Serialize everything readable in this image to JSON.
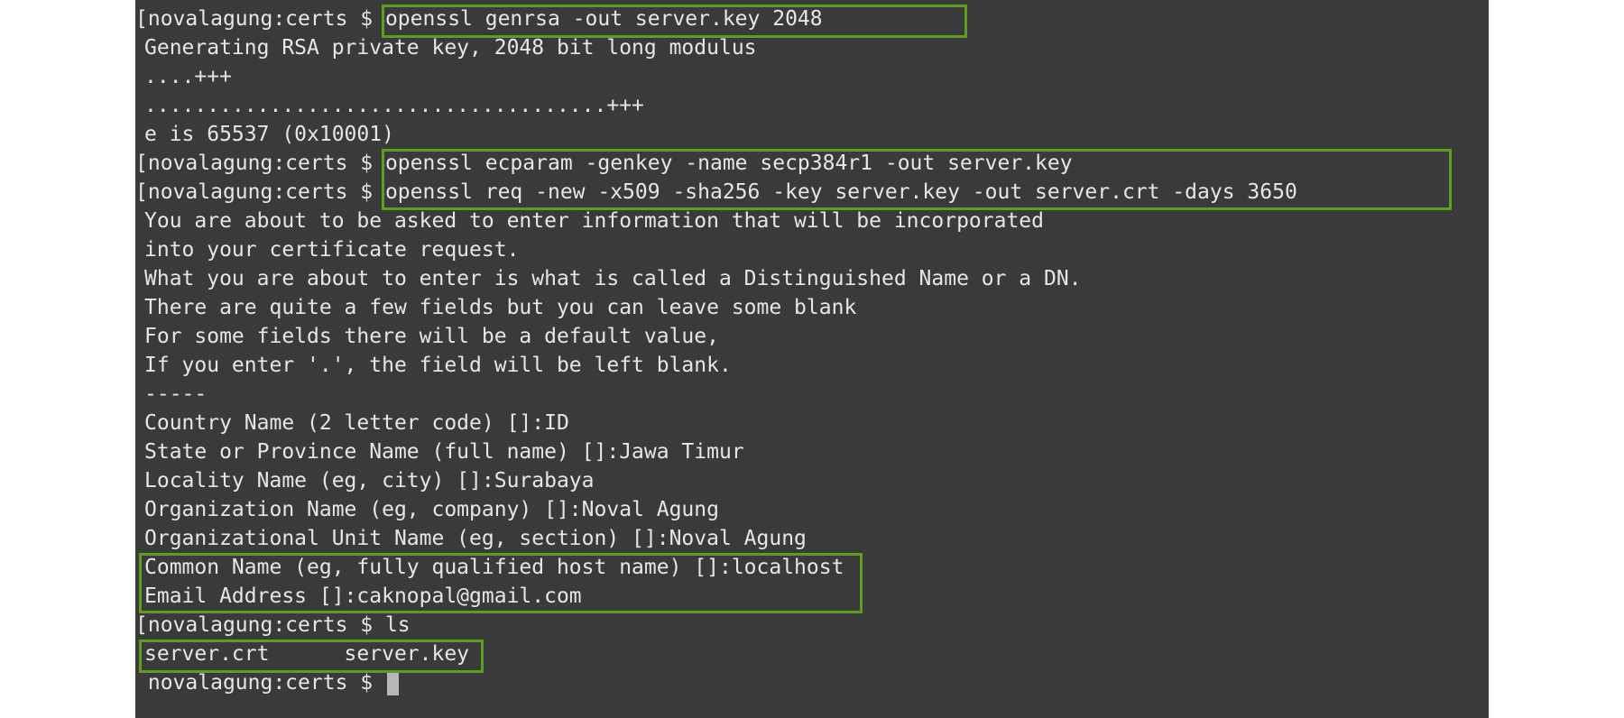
{
  "terminal": {
    "prompt": "novalagung:certs $",
    "prompt_open_bracket": "[",
    "lines": [
      {
        "type": "cmd",
        "bracket": true,
        "text": "openssl genrsa -out server.key 2048"
      },
      {
        "type": "out",
        "text": "Generating RSA private key, 2048 bit long modulus"
      },
      {
        "type": "out",
        "text": "....+++"
      },
      {
        "type": "out",
        "text": ".....................................+++"
      },
      {
        "type": "out",
        "text": "e is 65537 (0x10001)"
      },
      {
        "type": "cmd",
        "bracket": true,
        "text": "openssl ecparam -genkey -name secp384r1 -out server.key"
      },
      {
        "type": "cmd",
        "bracket": true,
        "text": "openssl req -new -x509 -sha256 -key server.key -out server.crt -days 3650"
      },
      {
        "type": "out",
        "text": "You are about to be asked to enter information that will be incorporated"
      },
      {
        "type": "out",
        "text": "into your certificate request."
      },
      {
        "type": "out",
        "text": "What you are about to enter is what is called a Distinguished Name or a DN."
      },
      {
        "type": "out",
        "text": "There are quite a few fields but you can leave some blank"
      },
      {
        "type": "out",
        "text": "For some fields there will be a default value,"
      },
      {
        "type": "out",
        "text": "If you enter '.', the field will be left blank."
      },
      {
        "type": "out",
        "text": "-----"
      },
      {
        "type": "out",
        "text": "Country Name (2 letter code) []:ID"
      },
      {
        "type": "out",
        "text": "State or Province Name (full name) []:Jawa Timur"
      },
      {
        "type": "out",
        "text": "Locality Name (eg, city) []:Surabaya"
      },
      {
        "type": "out",
        "text": "Organization Name (eg, company) []:Noval Agung"
      },
      {
        "type": "out",
        "text": "Organizational Unit Name (eg, section) []:Noval Agung"
      },
      {
        "type": "out",
        "text": "Common Name (eg, fully qualified host name) []:localhost"
      },
      {
        "type": "out",
        "text": "Email Address []:caknopal@gmail.com"
      },
      {
        "type": "cmd",
        "bracket": true,
        "text": "ls"
      },
      {
        "type": "out",
        "text": "server.crt      server.key"
      },
      {
        "type": "cmd",
        "bracket": false,
        "text": "",
        "cursor": true
      }
    ]
  },
  "colors": {
    "background": "#3a3a3a",
    "text": "#e6e6e6",
    "highlight_border": "#5f9d1f",
    "cursor": "#b8b8b8"
  }
}
